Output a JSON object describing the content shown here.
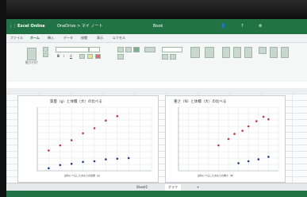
{
  "app": {
    "name": "Excel Online",
    "file": "OneDrive > マイ ノート",
    "center_title": "Book"
  },
  "titlebar_right": {
    "user_icon": "user-icon",
    "help": "?"
  },
  "ribbon": {
    "tabs": [
      "ファイル",
      "ホーム",
      "挿入",
      "データ",
      "校閲",
      "表示",
      "エクセル"
    ],
    "paste_label": "貼り付け"
  },
  "chart1": {
    "title": "質量（g）と体積（大）の比べる",
    "xlabel": "ばねにつるしたおもりの質量（g）"
  },
  "chart2": {
    "title": "重さ（N）と体積（大）の比べる",
    "xlabel": "ばねにつるしたおもりの重さ（N）"
  },
  "chart_data": [
    {
      "type": "scatter",
      "title": "質量（g）と体積（大）の比べる",
      "xlabel": "ばねにつるしたおもりの質量（g）",
      "xlim": [
        0,
        10
      ],
      "ylim": [
        0,
        10
      ],
      "series": [
        {
          "color": "#c0394b",
          "points": [
            [
              1,
              3.2
            ],
            [
              2,
              4.0
            ],
            [
              3,
              4.8
            ],
            [
              4,
              5.9
            ],
            [
              5,
              6.7
            ],
            [
              6,
              7.9
            ],
            [
              7,
              8.6
            ]
          ]
        },
        {
          "color": "#1f3e8a",
          "points": [
            [
              1,
              0.4
            ],
            [
              2,
              0.9
            ],
            [
              3,
              1.1
            ],
            [
              4,
              1.4
            ],
            [
              5,
              1.5
            ],
            [
              6,
              1.8
            ],
            [
              7,
              1.9
            ],
            [
              8,
              2.0
            ]
          ]
        }
      ]
    },
    {
      "type": "scatter",
      "title": "重さ（N）と体積（大）の比べる",
      "xlabel": "ばねにつるしたおもりの重さ（N）",
      "xlim": [
        0,
        10
      ],
      "ylim": [
        0,
        10
      ],
      "series": [
        {
          "color": "#c0394b",
          "points": [
            [
              4,
              4.0
            ],
            [
              5,
              5.0
            ],
            [
              5.6,
              5.8
            ],
            [
              6.4,
              6.3
            ],
            [
              7,
              7.0
            ],
            [
              7.8,
              7.8
            ],
            [
              8.5,
              8.5
            ],
            [
              9,
              8.1
            ]
          ]
        },
        {
          "color": "#1f3e8a",
          "points": [
            [
              6,
              1.2
            ],
            [
              7,
              1.5
            ],
            [
              8,
              1.8
            ],
            [
              9,
              2.2
            ]
          ]
        }
      ]
    }
  ],
  "sheet_tabs": [
    "Sheet1",
    "グラフ",
    "+"
  ]
}
